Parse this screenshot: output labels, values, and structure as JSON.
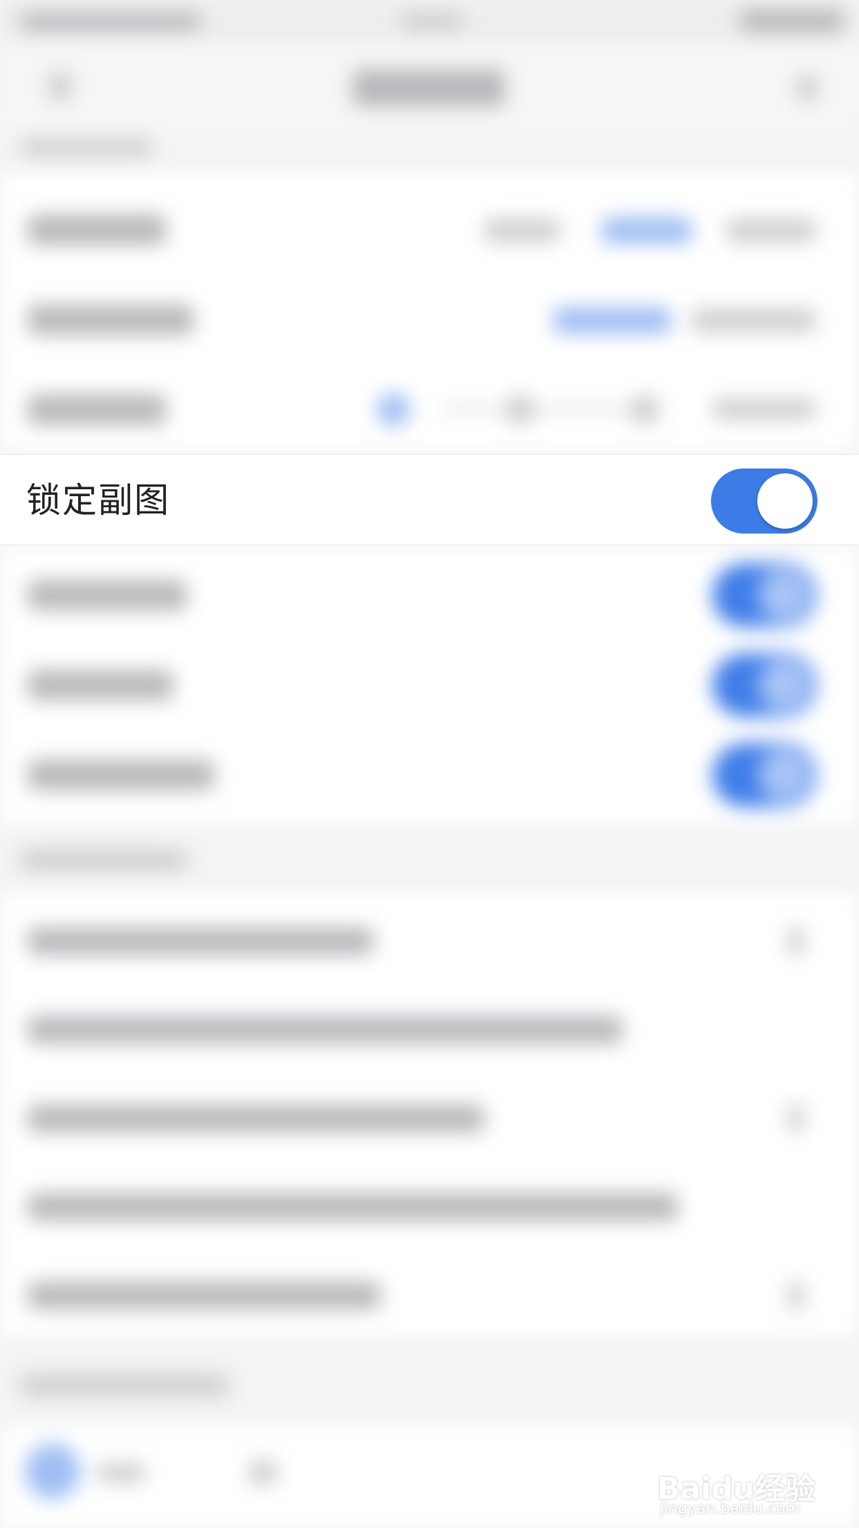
{
  "settings": {
    "lock_subchart": {
      "label": "锁定副图",
      "enabled": true
    }
  },
  "colors": {
    "accent": "#3C7CE6",
    "toggle_knob": "#FFFFFF",
    "row_background": "#FFFFFF",
    "page_background": "#F4F4F5"
  },
  "watermark": {
    "brand": "Baidu经验",
    "url": "jingyan.baidu.com"
  }
}
